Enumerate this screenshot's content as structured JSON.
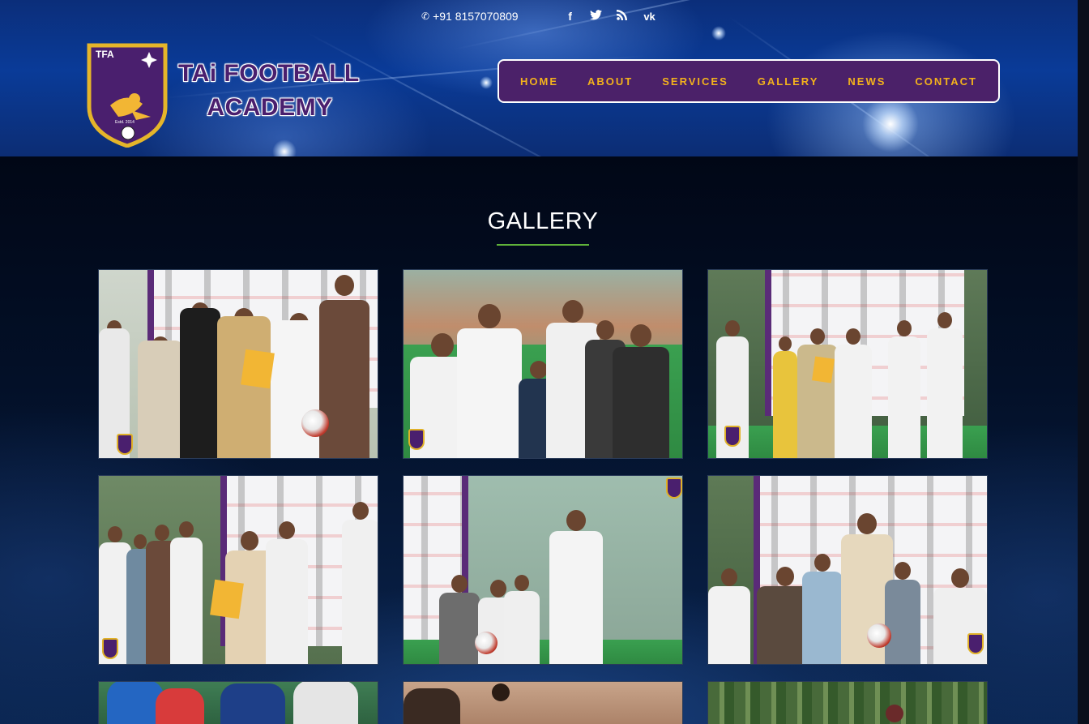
{
  "topbar": {
    "phone": "+91 8157070809",
    "phone_icon": "phone-icon",
    "social_icons": [
      "facebook-icon",
      "twitter-icon",
      "rss-icon",
      "vk-icon"
    ]
  },
  "logo": {
    "badge_text": "TFA",
    "badge_sub": "Estd. 2014",
    "line1": "TAi FOOTBALL",
    "line2": "ACADEMY"
  },
  "nav": {
    "items": [
      "HOME",
      "ABOUT",
      "SERVICES",
      "GALLERY",
      "NEWS",
      "CONTACT"
    ]
  },
  "gallery": {
    "title": "GALLERY",
    "accent_color": "#5fb23a"
  },
  "colors": {
    "nav_bg": "#4b2169",
    "nav_text": "#f3b21c",
    "page_bg": "#020b1e",
    "header_blue": "#0a3b98"
  }
}
